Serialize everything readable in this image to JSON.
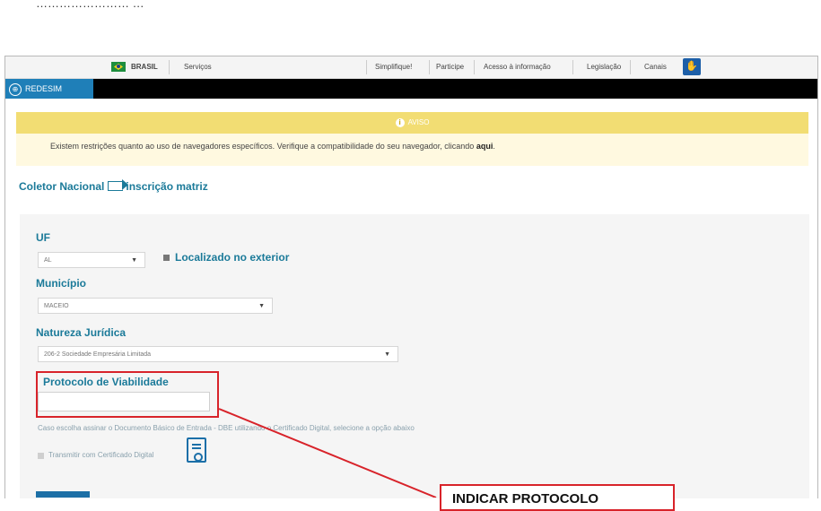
{
  "gov_bar": {
    "country": "BRASIL",
    "services": "Serviços",
    "links": [
      "Simplifique!",
      "Participe",
      "Acesso à informação",
      "Legislação",
      "Canais"
    ]
  },
  "brand": {
    "name": "REDESIM"
  },
  "notice": {
    "title": "AVISO",
    "text": "Existem restrições quanto ao uso de navegadores específicos. Verifique a compatibilidade do seu navegador, clicando",
    "link": "aqui"
  },
  "breadcrumb": {
    "root": "Coletor Nacional",
    "current": "inscrição matriz"
  },
  "form": {
    "uf_label": "UF",
    "uf_value": "AL",
    "exterior_label": "Localizado no exterior",
    "municipio_label": "Município",
    "municipio_value": "MACEIO",
    "natureza_label": "Natureza Jurídica",
    "natureza_value": "206-2 Sociedade Empresária Limitada",
    "protocolo_label": "Protocolo de Viabilidade",
    "protocolo_value": "",
    "dbe_hint": "Caso escolha assinar o Documento Básico de Entrada - DBE utilizando o Certificado Digital, selecione a opção abaixo",
    "cert_label": "Transmitir com Certificado Digital"
  },
  "annotation": {
    "callout_text": "INDICAR PROTOCOLO",
    "color": "#d8232a"
  }
}
